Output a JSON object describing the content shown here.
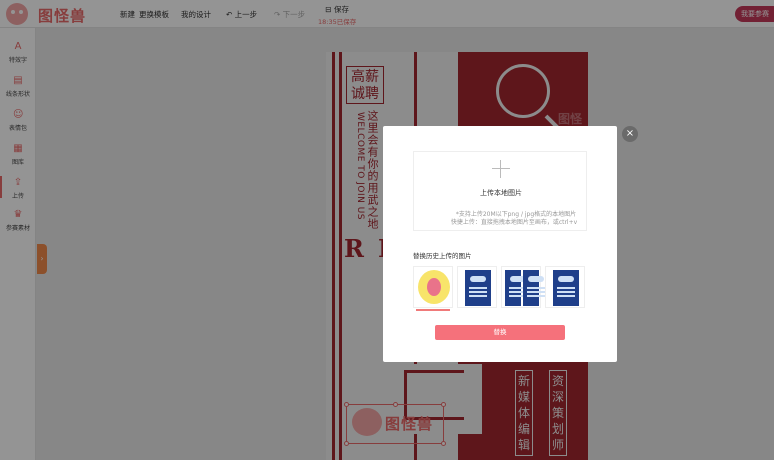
{
  "app": {
    "logo_text": "图怪兽"
  },
  "topbar": {
    "menu": [
      {
        "label": "新建",
        "disabled": false
      },
      {
        "label": "更换模板",
        "disabled": false
      },
      {
        "label": "我的设计",
        "disabled": false
      },
      {
        "label": "上一步",
        "disabled": false
      },
      {
        "label": "下一步",
        "disabled": true
      }
    ],
    "save_label": "保存",
    "save_time": "18:35已保存",
    "contest_button": "我要参赛"
  },
  "sidebar": {
    "items": [
      {
        "label": "特效字",
        "icon": "text-effect-icon"
      },
      {
        "label": "线条形状",
        "icon": "shapes-icon"
      },
      {
        "label": "表情包",
        "icon": "emoji-icon"
      },
      {
        "label": "图库",
        "icon": "gallery-icon"
      },
      {
        "label": "上传",
        "icon": "upload-icon",
        "active": true
      },
      {
        "label": "参赛素材",
        "icon": "trophy-icon"
      }
    ],
    "collapse_glyph": "›"
  },
  "poster": {
    "hiring": "高薪诚聘",
    "cn_vertical": "这里会有你的用武之地",
    "en_vertical": "WELCOME TO JOIN US",
    "letters": [
      "R",
      "I"
    ],
    "right_box_1": "新媒体编辑",
    "right_box_2": "资深策划师",
    "sticker_text": "图怪兽",
    "ghost_badge": "图怪兽"
  },
  "modal": {
    "upload_title": "上传本地图片",
    "upload_hint_1": "*支持上传20M以下png / jpg格式的本地图片",
    "upload_hint_2": "快捷上传：直接拖拽本地图片至画布，或ctrl+v",
    "history_label": "替换历史上传的图片",
    "replace_button": "替换",
    "close_glyph": "×"
  },
  "colors": {
    "brand": "#e96a6a",
    "poster_red": "#a3262f",
    "button": "#f5717b",
    "contest": "#c5395b"
  }
}
